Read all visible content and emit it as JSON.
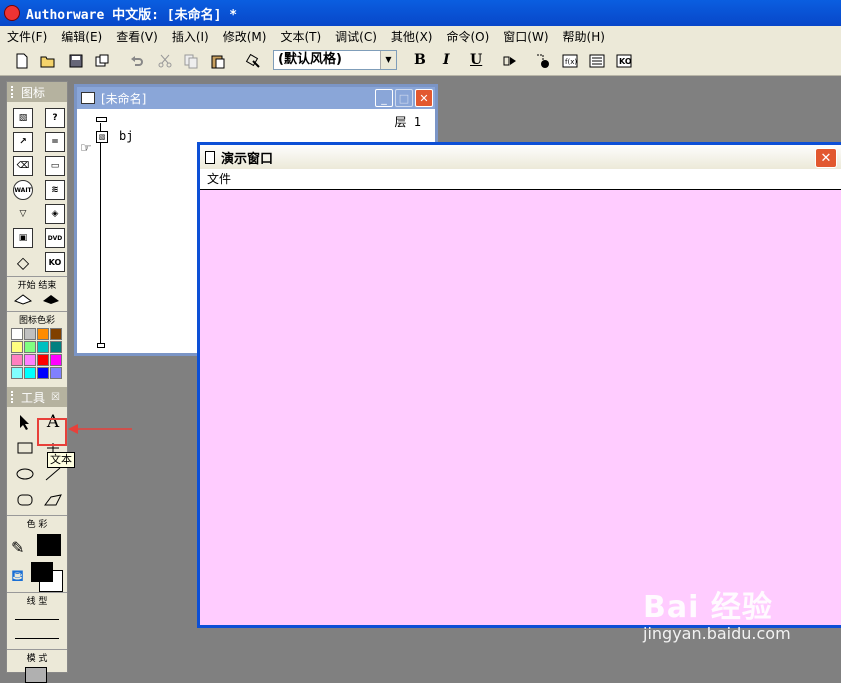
{
  "app": {
    "title": "Authorware 中文版: [未命名] *"
  },
  "menu": [
    "文件(F)",
    "编辑(E)",
    "查看(V)",
    "插入(I)",
    "修改(M)",
    "文本(T)",
    "调试(C)",
    "其他(X)",
    "命令(O)",
    "窗口(W)",
    "帮助(H)"
  ],
  "toolbar": {
    "style_value": "(默认风格)",
    "bold": "B",
    "italic": "I",
    "underline": "U"
  },
  "palette": {
    "title": "图标",
    "start_end_label": "开始 结束",
    "icon_color_label": "图标色彩",
    "tools_title": "工具",
    "color_label": "色 彩",
    "line_label": "线 型",
    "mode_label": "模 式",
    "swatch_colors": [
      "#ffffff",
      "#c0c0c0",
      "#ff8c00",
      "#804000",
      "#ffff80",
      "#80ff80",
      "#00c0c0",
      "#008080",
      "#ff80c0",
      "#ff80ff",
      "#ff0000",
      "#ff00ff",
      "#80ffff",
      "#00ffff",
      "#0000ff",
      "#8080ff"
    ],
    "text_tool": "A"
  },
  "flow_window": {
    "title": "[未命名]",
    "level": "层 1",
    "item": "bj"
  },
  "present_window": {
    "title": "演示窗口",
    "menu_file": "文件",
    "background": "#ffccff"
  },
  "tooltip": "文本",
  "watermark": {
    "line1": "Bai 经验",
    "line2": "jingyan.baidu.com"
  }
}
